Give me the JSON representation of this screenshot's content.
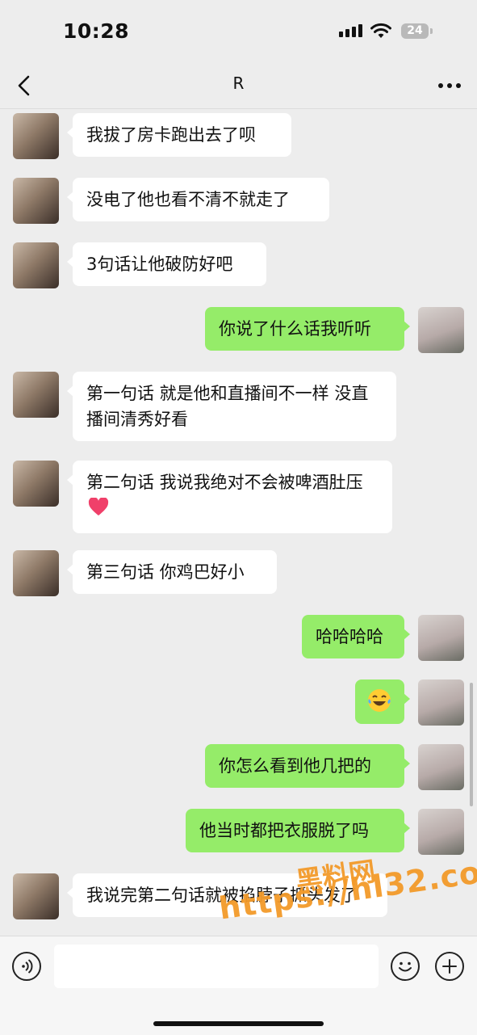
{
  "status_bar": {
    "time": "10:28",
    "battery": "24"
  },
  "header": {
    "title": "R",
    "back_icon": "chevron-left-icon",
    "more_icon": "more-dots-icon"
  },
  "messages": [
    {
      "side": "in",
      "text": "我拔了房卡跑出去了呗"
    },
    {
      "side": "in",
      "text": "没电了他也看不清不就走了"
    },
    {
      "side": "in",
      "text": "3句话让他破防好吧"
    },
    {
      "side": "out",
      "text": "你说了什么话我听听"
    },
    {
      "side": "in",
      "text": "第一句话 就是他和直播间不一样 没直播间清秀好看"
    },
    {
      "side": "in",
      "text": "第二句话 我说我绝对不会被啤酒肚压",
      "emoji": "red-heart"
    },
    {
      "side": "in",
      "text": "第三句话 你鸡巴好小"
    },
    {
      "side": "out",
      "text": "哈哈哈哈"
    },
    {
      "side": "out",
      "text": "",
      "emoji": "laughing-tears"
    },
    {
      "side": "out",
      "text": "你怎么看到他几把的"
    },
    {
      "side": "out",
      "text": "他当时都把衣服脱了吗"
    },
    {
      "side": "in",
      "text": "我说完第二句话就被掐脖子抓头发了"
    }
  ],
  "watermark": {
    "name": "黑料网",
    "url": "https://hl32.co"
  },
  "input_bar": {
    "voice_icon": "voice-icon",
    "emoji_icon": "emoji-icon",
    "add_icon": "plus-icon",
    "placeholder": ""
  },
  "colors": {
    "background": "#ededed",
    "incoming_bubble": "#ffffff",
    "outgoing_bubble": "#95ec69",
    "watermark": "#f39a2a"
  }
}
